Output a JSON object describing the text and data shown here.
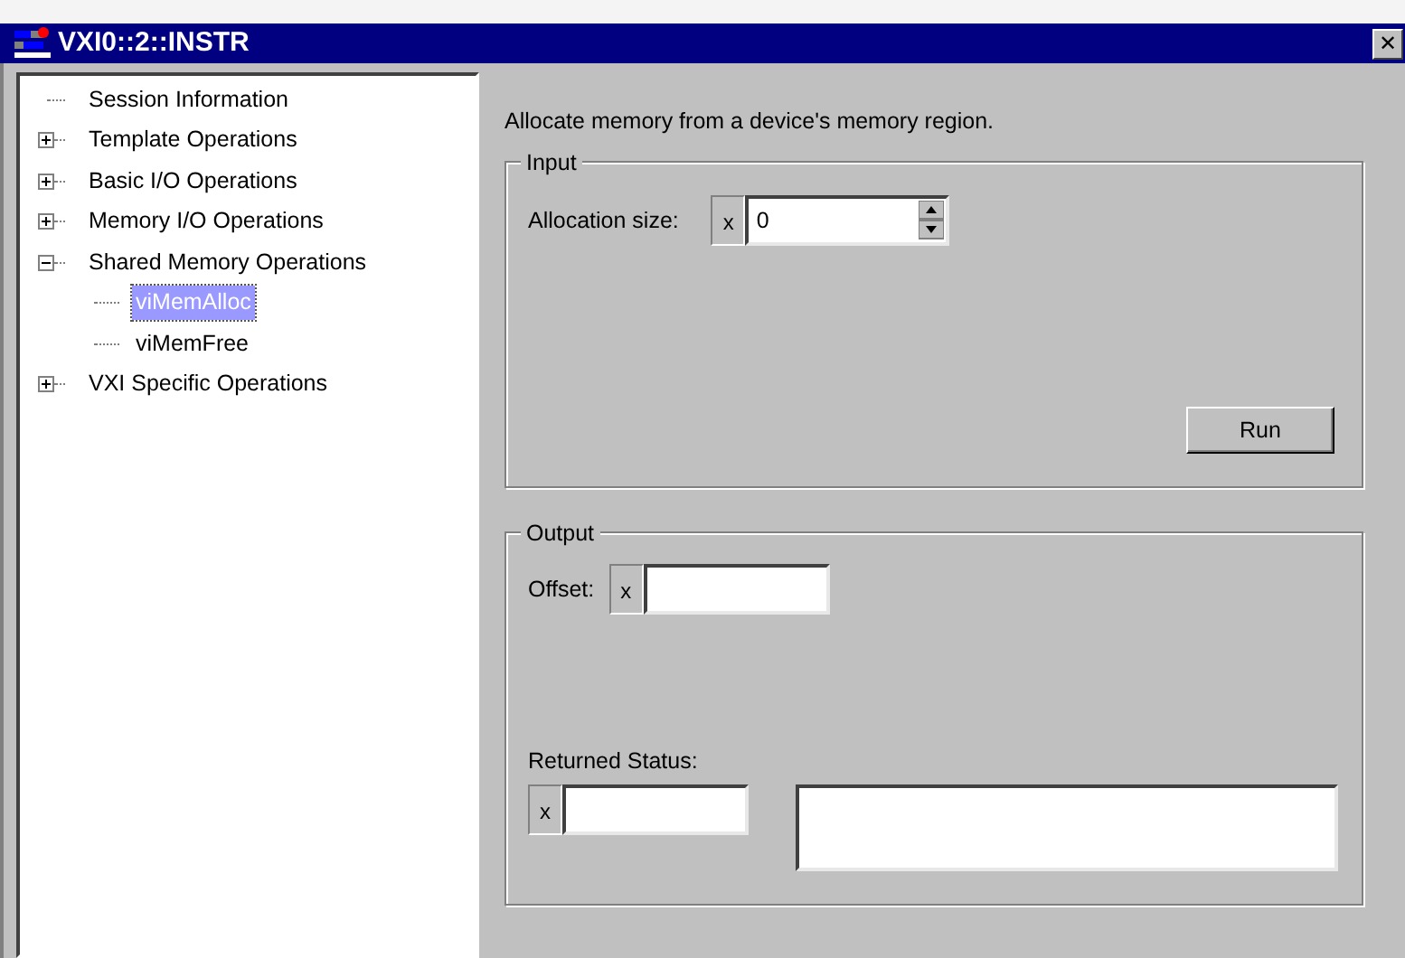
{
  "window": {
    "title": "VXI0::2::INSTR",
    "close": "✕"
  },
  "tree": [
    {
      "label": "Session Information",
      "kind": "leaf",
      "selected": false
    },
    {
      "label": "Template Operations",
      "kind": "group",
      "expanded": false,
      "selected": false
    },
    {
      "label": "Basic I/O Operations",
      "kind": "group",
      "expanded": false,
      "selected": false
    },
    {
      "label": "Memory I/O Operations",
      "kind": "group",
      "expanded": false,
      "selected": false
    },
    {
      "label": "Shared Memory Operations",
      "kind": "group",
      "expanded": true,
      "selected": false,
      "children": [
        {
          "label": "viMemAlloc",
          "kind": "leaf",
          "selected": true
        },
        {
          "label": "viMemFree",
          "kind": "leaf",
          "selected": false
        }
      ]
    },
    {
      "label": "VXI Specific Operations",
      "kind": "group",
      "expanded": false,
      "selected": false
    }
  ],
  "description": "Allocate memory from a device's memory region.",
  "input": {
    "title": "Input",
    "allocation_size": {
      "label": "Allocation size:",
      "prefix": "x",
      "value": "0"
    },
    "run_button": "Run"
  },
  "output": {
    "title": "Output",
    "offset": {
      "label": "Offset:",
      "prefix": "x"
    },
    "returned_status": {
      "label": "Returned Status:",
      "prefix": "x"
    }
  }
}
